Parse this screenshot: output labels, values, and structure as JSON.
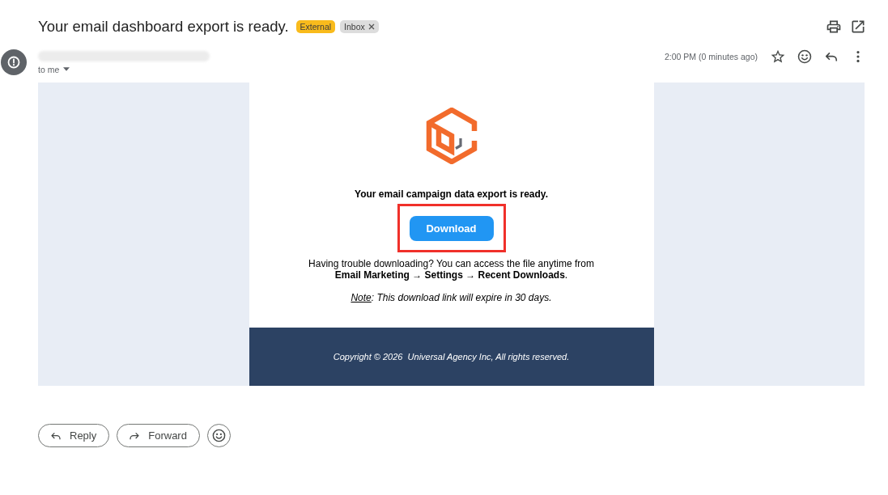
{
  "header": {
    "subject": "Your email dashboard export is ready.",
    "labels": [
      {
        "text": "External",
        "color": "#f9bb1c",
        "removable": false
      },
      {
        "text": "Inbox",
        "color": "#dddddd",
        "removable": true
      }
    ]
  },
  "message": {
    "sender_redacted": true,
    "recipient": "to me",
    "time": "2:00 PM (0 minutes ago)",
    "starred": false
  },
  "email": {
    "heading": "Your email campaign data export is ready.",
    "button": {
      "label": "Download",
      "highlighted": true
    },
    "help": "Having trouble downloading? You can access the file anytime from **Email Marketing → Settings → Recent Downloads**.",
    "note": {
      "label": "Note",
      "text": ": This download link will expire in 30 days."
    },
    "footer": "Copyright © 2026  Universal Agency Inc, All rights reserved."
  },
  "actions": [
    {
      "kind": "reply",
      "label": "Reply"
    },
    {
      "kind": "forward",
      "label": "Forward"
    },
    {
      "kind": "react"
    }
  ]
}
